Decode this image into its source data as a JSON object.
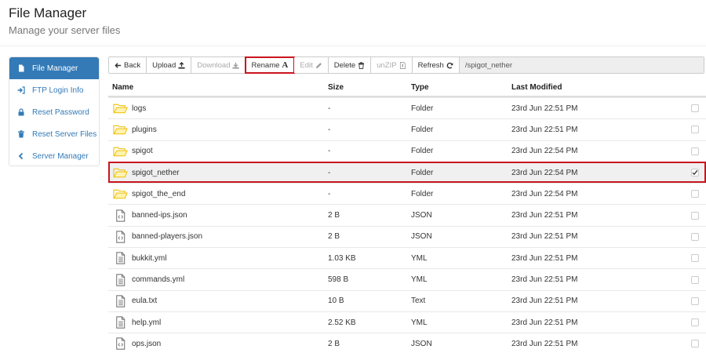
{
  "header": {
    "title": "File Manager",
    "subtitle": "Manage your server files"
  },
  "sidebar": {
    "items": [
      {
        "label": "File Manager",
        "icon": "file-icon",
        "active": true
      },
      {
        "label": "FTP Login Info",
        "icon": "sign-in-icon"
      },
      {
        "label": "Reset Password",
        "icon": "lock-icon"
      },
      {
        "label": "Reset Server Files",
        "icon": "trash-icon"
      },
      {
        "label": "Server Manager",
        "icon": "chevron-left-icon"
      }
    ]
  },
  "toolbar": {
    "back": "Back",
    "upload": "Upload",
    "download": "Download",
    "rename": "Rename",
    "edit": "Edit",
    "delete": "Delete",
    "unzip": "unZIP",
    "refresh": "Refresh",
    "path": "/spigot_nether"
  },
  "table": {
    "headers": {
      "name": "Name",
      "size": "Size",
      "type": "Type",
      "modified": "Last Modified"
    },
    "rows": [
      {
        "name": "logs",
        "size": "-",
        "type": "Folder",
        "modified": "23rd Jun 22:51 PM",
        "icon": "folder-open-icon",
        "checked": false
      },
      {
        "name": "plugins",
        "size": "-",
        "type": "Folder",
        "modified": "23rd Jun 22:51 PM",
        "icon": "folder-open-icon",
        "checked": false
      },
      {
        "name": "spigot",
        "size": "-",
        "type": "Folder",
        "modified": "23rd Jun 22:54 PM",
        "icon": "folder-open-icon",
        "checked": false
      },
      {
        "name": "spigot_nether",
        "size": "-",
        "type": "Folder",
        "modified": "23rd Jun 22:54 PM",
        "icon": "folder-open-icon",
        "checked": true
      },
      {
        "name": "spigot_the_end",
        "size": "-",
        "type": "Folder",
        "modified": "23rd Jun 22:54 PM",
        "icon": "folder-open-icon",
        "checked": false
      },
      {
        "name": "banned-ips.json",
        "size": "2 B",
        "type": "JSON",
        "modified": "23rd Jun 22:51 PM",
        "icon": "code-file-icon",
        "checked": false
      },
      {
        "name": "banned-players.json",
        "size": "2 B",
        "type": "JSON",
        "modified": "23rd Jun 22:51 PM",
        "icon": "code-file-icon",
        "checked": false
      },
      {
        "name": "bukkit.yml",
        "size": "1.03 KB",
        "type": "YML",
        "modified": "23rd Jun 22:51 PM",
        "icon": "text-file-icon",
        "checked": false
      },
      {
        "name": "commands.yml",
        "size": "598 B",
        "type": "YML",
        "modified": "23rd Jun 22:51 PM",
        "icon": "text-file-icon",
        "checked": false
      },
      {
        "name": "eula.txt",
        "size": "10 B",
        "type": "Text",
        "modified": "23rd Jun 22:51 PM",
        "icon": "text-file-icon",
        "checked": false
      },
      {
        "name": "help.yml",
        "size": "2.52 KB",
        "type": "YML",
        "modified": "23rd Jun 22:51 PM",
        "icon": "text-file-icon",
        "checked": false
      },
      {
        "name": "ops.json",
        "size": "2 B",
        "type": "JSON",
        "modified": "23rd Jun 22:51 PM",
        "icon": "code-file-icon",
        "checked": false
      }
    ]
  },
  "colors": {
    "accent": "#337ab7",
    "folder": "#f0c419",
    "highlight": "#c9151e"
  }
}
